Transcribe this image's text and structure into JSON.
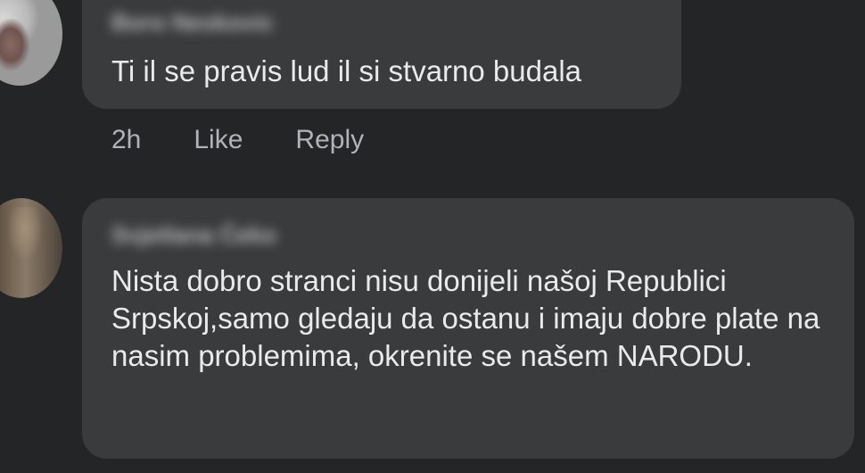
{
  "comments": [
    {
      "author": "Boro Neskovic",
      "text": "Ti il se pravis lud il si stvarno budala",
      "time": "2h",
      "like_label": "Like",
      "reply_label": "Reply"
    },
    {
      "author": "Svjetlana Ćeko",
      "text": "Nista dobro stranci nisu donijeli našoj Republici Srpskoj,samo gledaju da ostanu i imaju dobre plate na nasim problemima, okrenite se našem NARODU."
    }
  ]
}
